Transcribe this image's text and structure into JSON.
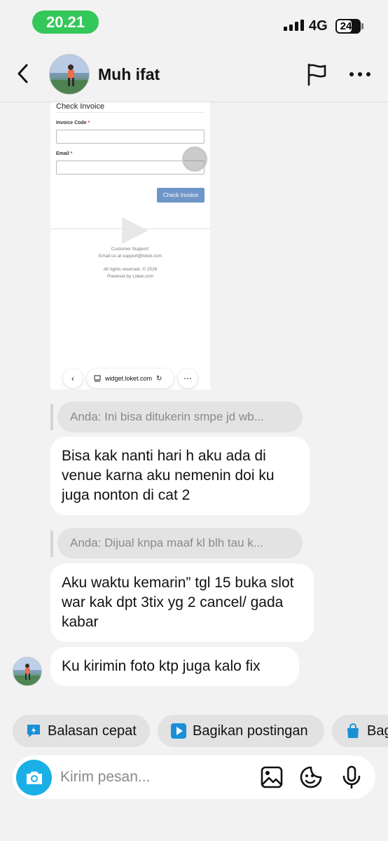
{
  "status_bar": {
    "time": "20.21",
    "network": "4G",
    "battery": "24"
  },
  "header": {
    "contact_name": "Muh ifat"
  },
  "shared_media": {
    "form_title": "Check Invoice",
    "invoice_code_label": "Invoice Code",
    "email_label": "Email",
    "required_mark": "*",
    "submit_label": "Check Invoice",
    "support_title": "Customer Support:",
    "support_email": "Email us at support@loket.com",
    "rights": "All rights reserved. © 2026",
    "powered_by": "Powered by Loket.com",
    "browser_url": "widget.loket.com"
  },
  "messages": [
    {
      "quote": "Anda: Ini bisa ditukerin smpe jd wb...",
      "text": "Bisa kak nanti hari h aku ada di venue karna aku nemenin doi ku juga nonton di cat 2"
    },
    {
      "quote": "Anda: Dijual knpa maaf kl blh tau k...",
      "text": "Aku waktu kemarin” tgl 15 buka slot war kak dpt 3tix yg 2 cancel/ gada kabar"
    },
    {
      "text": "Ku kirimin foto ktp juga kalo fix"
    }
  ],
  "quick_actions": [
    {
      "label": "Balasan cepat",
      "icon": "quick-reply-icon",
      "color": "#1a8fd6"
    },
    {
      "label": "Bagikan postingan",
      "icon": "share-post-icon",
      "color": "#1a8fd6"
    },
    {
      "label": "Bag",
      "icon": "shopping-bag-icon",
      "color": "#1a8fd6"
    }
  ],
  "composer": {
    "placeholder": "Kirim pesan..."
  },
  "colors": {
    "accent": "#1ab0e6",
    "time_pill": "#34c759",
    "bubble": "#ffffff",
    "background": "#f2f2f2"
  }
}
